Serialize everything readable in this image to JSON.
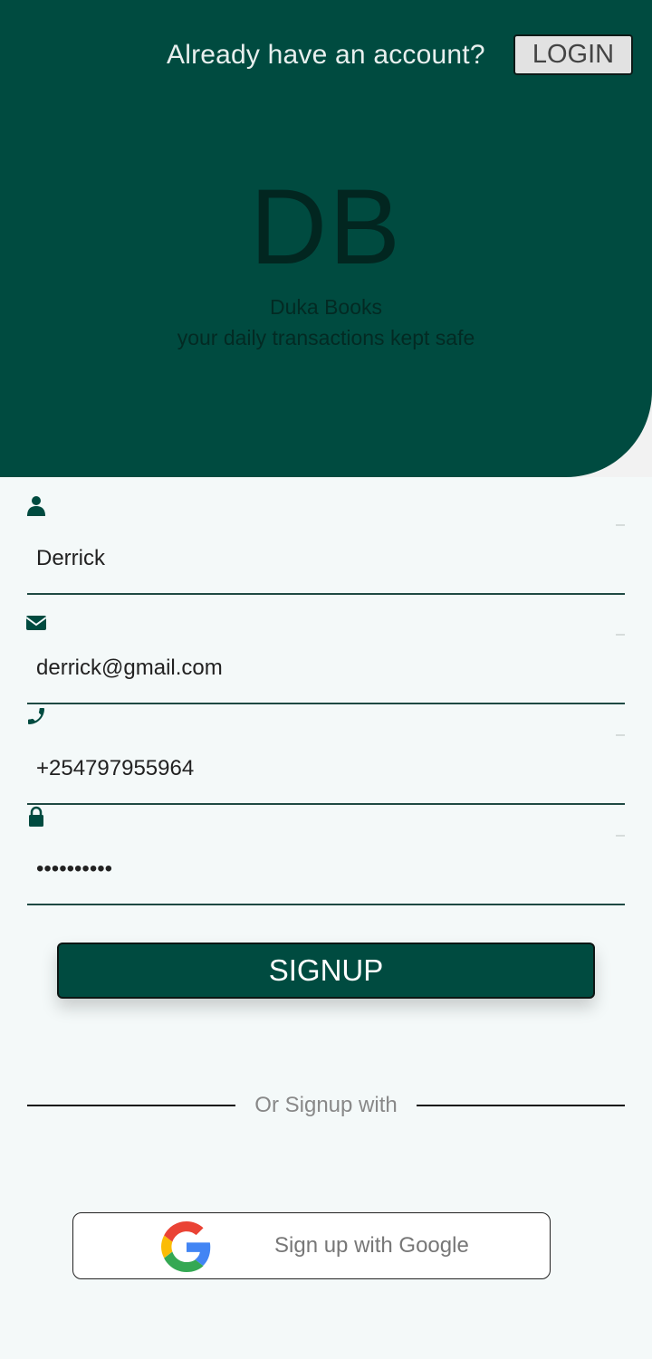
{
  "header": {
    "prompt": "Already have an account?",
    "login_label": "LOGIN"
  },
  "brand": {
    "logo_text": "DB",
    "name": "Duka Books",
    "tagline": "your daily transactions kept safe"
  },
  "form": {
    "name_value": "Derrick",
    "email_value": "derrick@gmail.com",
    "phone_value": "+254797955964",
    "password_value": "••••••••••",
    "signup_label": "SIGNUP"
  },
  "alt": {
    "divider_text": "Or Signup with",
    "google_label": "Sign up with Google"
  },
  "colors": {
    "primary": "#004b40",
    "background": "#f4f9f9"
  }
}
